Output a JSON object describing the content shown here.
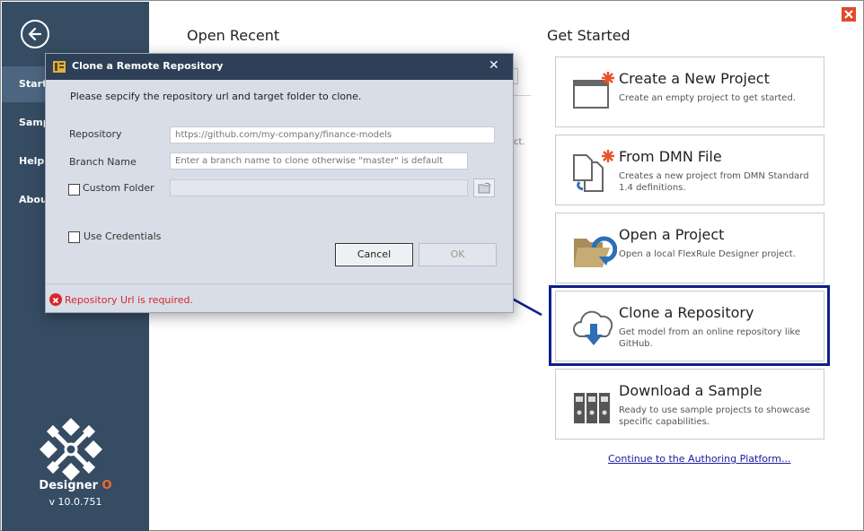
{
  "sidebar": {
    "items": [
      {
        "label": "Start"
      },
      {
        "label": "Samp"
      },
      {
        "label": "Help"
      },
      {
        "label": "Abou"
      }
    ],
    "brand_name": "Designer",
    "brand_o": "O",
    "version": "v 10.0.751"
  },
  "main": {
    "open_recent_title": "Open Recent",
    "recent_fragment": "ct.",
    "get_started_title": "Get Started",
    "cards": [
      {
        "title": "Create a New Project",
        "desc": "Create an empty project to get started.",
        "icon": "new-project-icon"
      },
      {
        "title": "From DMN File",
        "desc": "Creates a new project from DMN Standard 1.4 definitions.",
        "icon": "dmn-file-icon"
      },
      {
        "title": "Open a Project",
        "desc": "Open a local FlexRule Designer project.",
        "icon": "open-folder-icon"
      },
      {
        "title": "Clone a Repository",
        "desc": "Get model from an online repository like GitHub.",
        "icon": "cloud-download-icon"
      },
      {
        "title": "Download a Sample",
        "desc": "Ready to use sample projects to showcase specific capabilities.",
        "icon": "binders-icon"
      }
    ],
    "continue_link": "Continue to the Authoring Platform..."
  },
  "dialog": {
    "title": "Clone a Remote Repository",
    "message": "Please sepcify the repository url and target folder to clone.",
    "repository_label": "Repository",
    "repository_placeholder": "https://github.com/my-company/finance-models",
    "branch_label": "Branch Name",
    "branch_placeholder": "Enter a branch name to clone otherwise \"master\" is default",
    "custom_folder_label": "Custom Folder",
    "use_credentials_label": "Use Credentials",
    "cancel_label": "Cancel",
    "ok_label": "OK",
    "error_text": "Repository Url is required."
  },
  "colors": {
    "sidebar": "#354c63",
    "dialog_titlebar": "#2d4058",
    "highlight": "#0d1f8a",
    "error": "#d9262b",
    "accent": "#f06a2a"
  }
}
